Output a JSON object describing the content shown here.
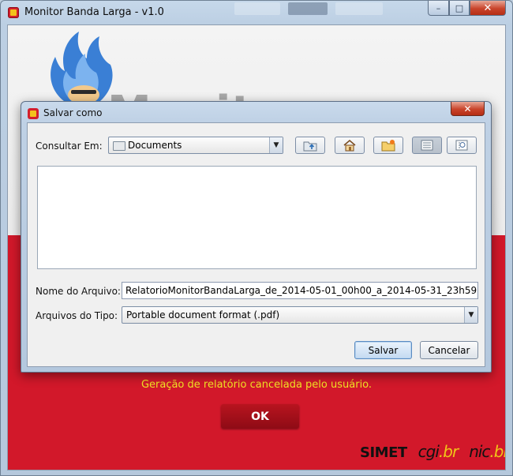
{
  "window": {
    "title": "Monitor Banda Larga - v1.0",
    "controls": {
      "minimize": "–",
      "maximize": "□",
      "close": "✕"
    }
  },
  "brand": {
    "logo_word": "Monitor",
    "status_message": "Geração de relatório cancelada pelo usuário.",
    "ok_label": "OK",
    "footer": {
      "simet": "SIMET",
      "cgi_main": "cgi",
      "cgi_suffix": ".br",
      "nic_main": "nic",
      "nic_suffix": ".br"
    }
  },
  "dialog": {
    "title": "Salvar como",
    "close": "✕",
    "look_in_label": "Consultar Em:",
    "look_in_value": "Documents",
    "toolbar": [
      {
        "name": "up-one-level-button",
        "icon": "folder-up-icon"
      },
      {
        "name": "home-button",
        "icon": "home-icon"
      },
      {
        "name": "new-folder-button",
        "icon": "new-folder-icon"
      },
      {
        "name": "list-view-button",
        "icon": "list-view-icon"
      },
      {
        "name": "details-view-button",
        "icon": "details-view-icon"
      }
    ],
    "file_name_label": "Nome do Arquivo:",
    "file_name_value": "RelatorioMonitorBandaLarga_de_2014-05-01_00h00_a_2014-05-31_23h59",
    "file_type_label": "Arquivos do Tipo:",
    "file_type_value": "Portable document format (.pdf)",
    "save_label": "Salvar",
    "cancel_label": "Cancelar"
  },
  "colors": {
    "accent_red": "#d2182a",
    "status_yellow": "#f3e325",
    "flame_blue": "#3a7fd5"
  }
}
